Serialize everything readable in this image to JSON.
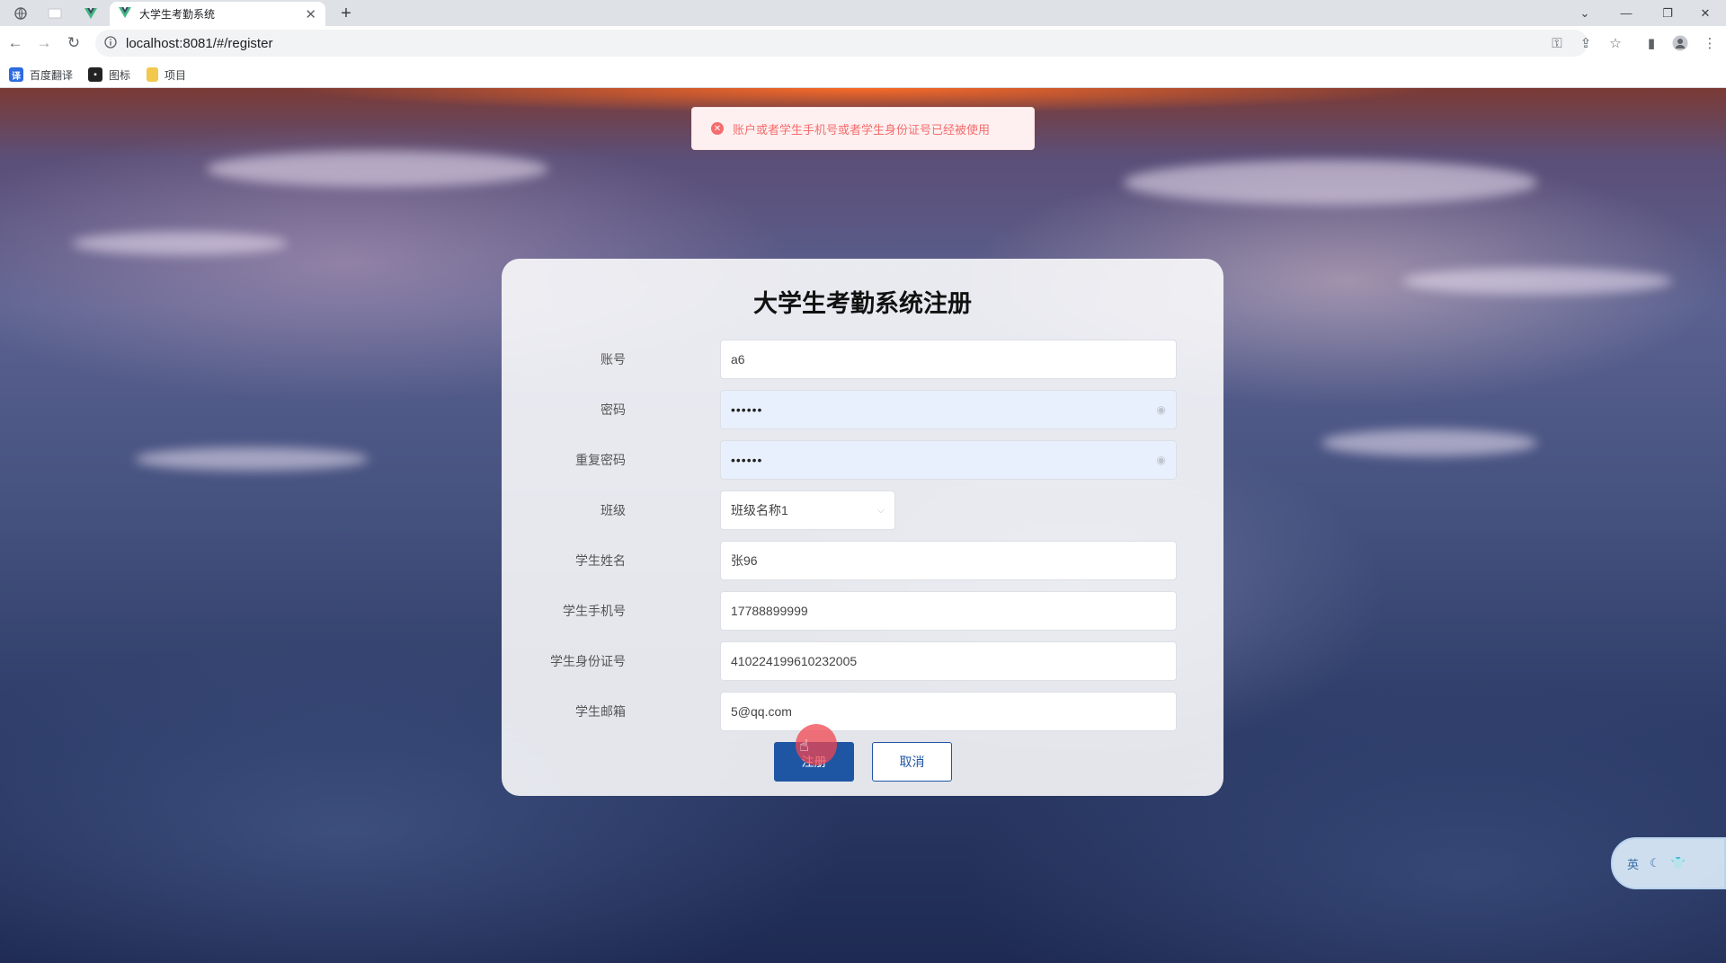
{
  "browser": {
    "tab_title": "大学生考勤系统",
    "url": "localhost:8081/#/register",
    "bookmarks": [
      "百度翻译",
      "图标",
      "项目"
    ]
  },
  "alert": {
    "message": "账户或者学生手机号或者学生身份证号已经被使用"
  },
  "form": {
    "title": "大学生考勤系统注册",
    "fields": [
      {
        "label": "账号",
        "value": "a6"
      },
      {
        "label": "密码",
        "value": "••••••"
      },
      {
        "label": "重复密码",
        "value": "••••••"
      },
      {
        "label": "班级",
        "value": "班级名称1"
      },
      {
        "label": "学生姓名",
        "value": "张96"
      },
      {
        "label": "学生手机号",
        "value": "17788899999"
      },
      {
        "label": "学生身份证号",
        "value": "410224199610232005"
      },
      {
        "label": "学生邮箱",
        "value": "5@qq.com"
      }
    ],
    "register_label": "注册",
    "cancel_label": "取消"
  },
  "ime": {
    "lang": "英"
  },
  "colors": {
    "primary": "#1f56a3",
    "alert": "#f56c6c"
  }
}
